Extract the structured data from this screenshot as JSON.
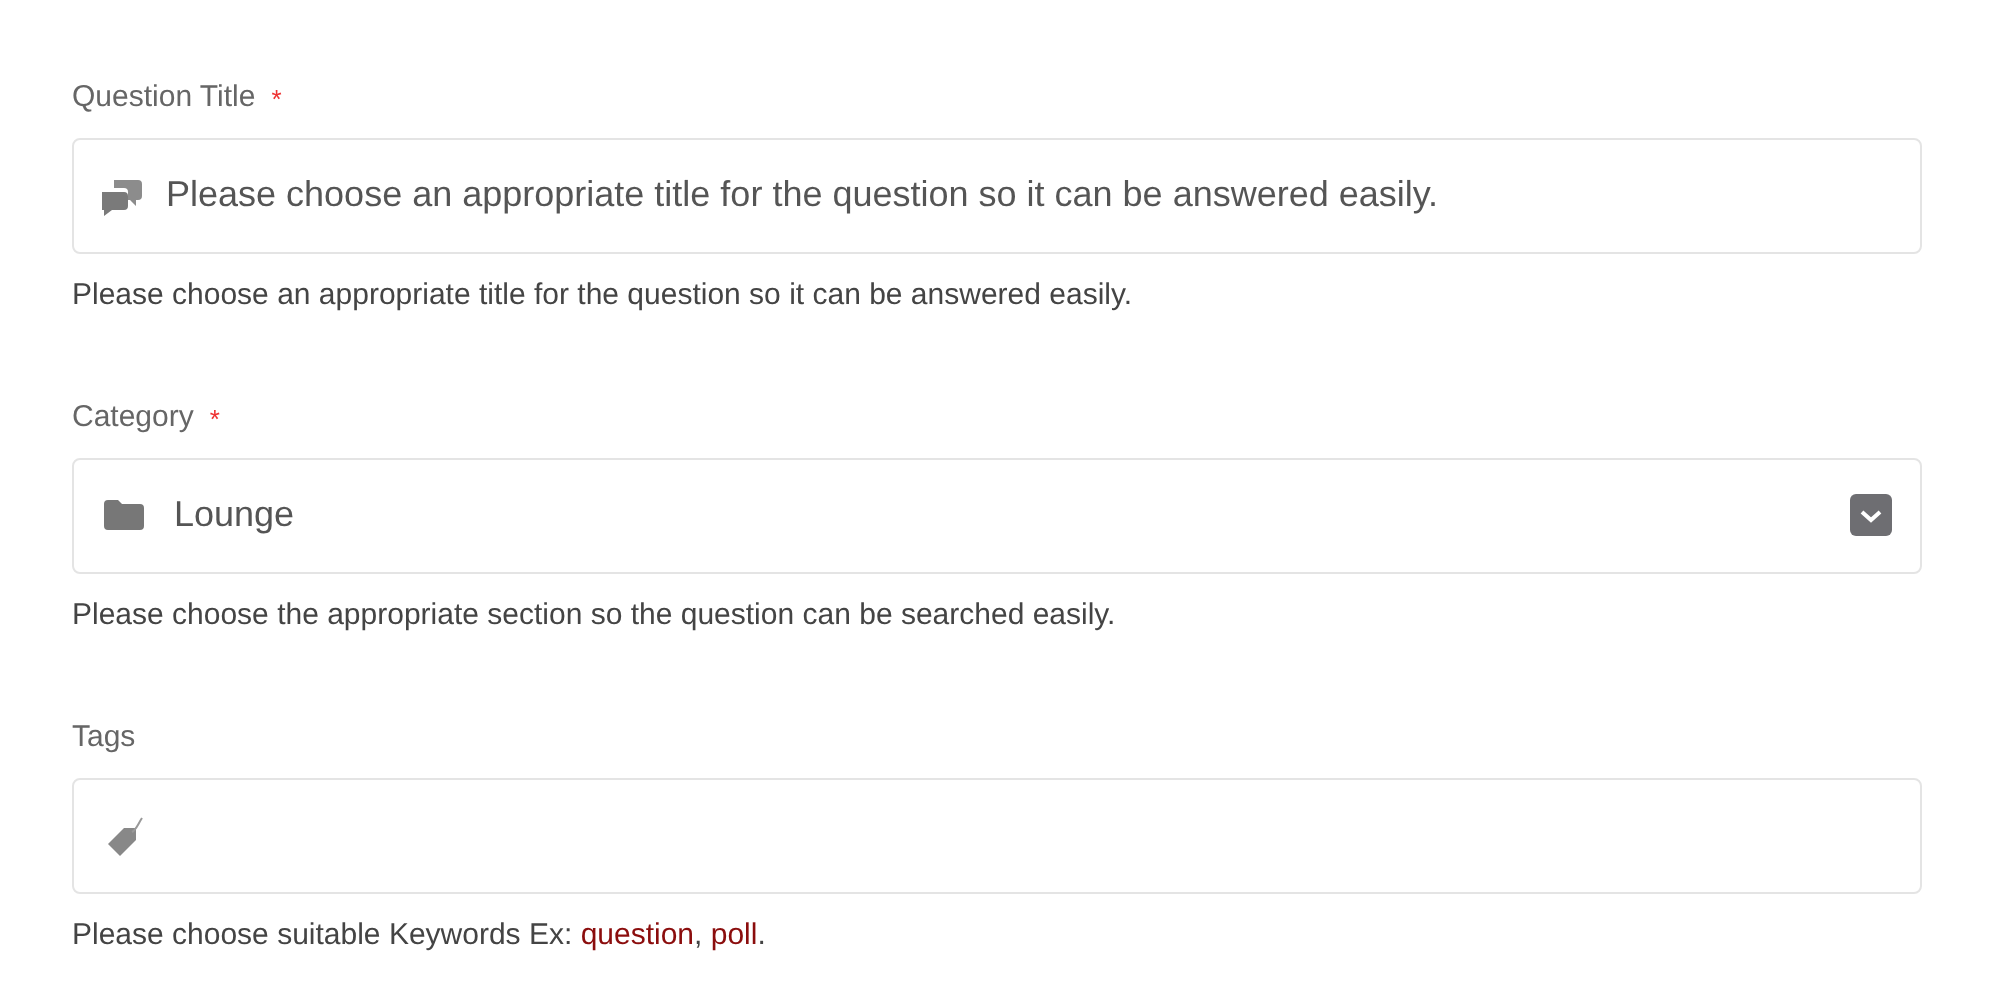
{
  "fields": [
    {
      "kind": "text",
      "label": "Question Title",
      "required_mark": "*",
      "placeholder": "Please choose an appropriate title for the question so it can be answered easily.",
      "hint": [
        {
          "kind": "text",
          "text": "Please choose an appropriate title for the question so it can be answered easily."
        }
      ]
    },
    {
      "kind": "select",
      "label": "Category",
      "required_mark": "*",
      "value": "Lounge",
      "hint": [
        {
          "kind": "text",
          "text": "Please choose the appropriate section so the question can be searched easily."
        }
      ]
    },
    {
      "kind": "tags",
      "label": "Tags",
      "hint": [
        {
          "kind": "text",
          "text": "Please choose suitable Keywords Ex: "
        },
        {
          "kind": "keyword",
          "text": "question"
        },
        {
          "kind": "text",
          "text": ", "
        },
        {
          "kind": "keyword",
          "text": "poll"
        },
        {
          "kind": "text",
          "text": "."
        }
      ]
    }
  ]
}
